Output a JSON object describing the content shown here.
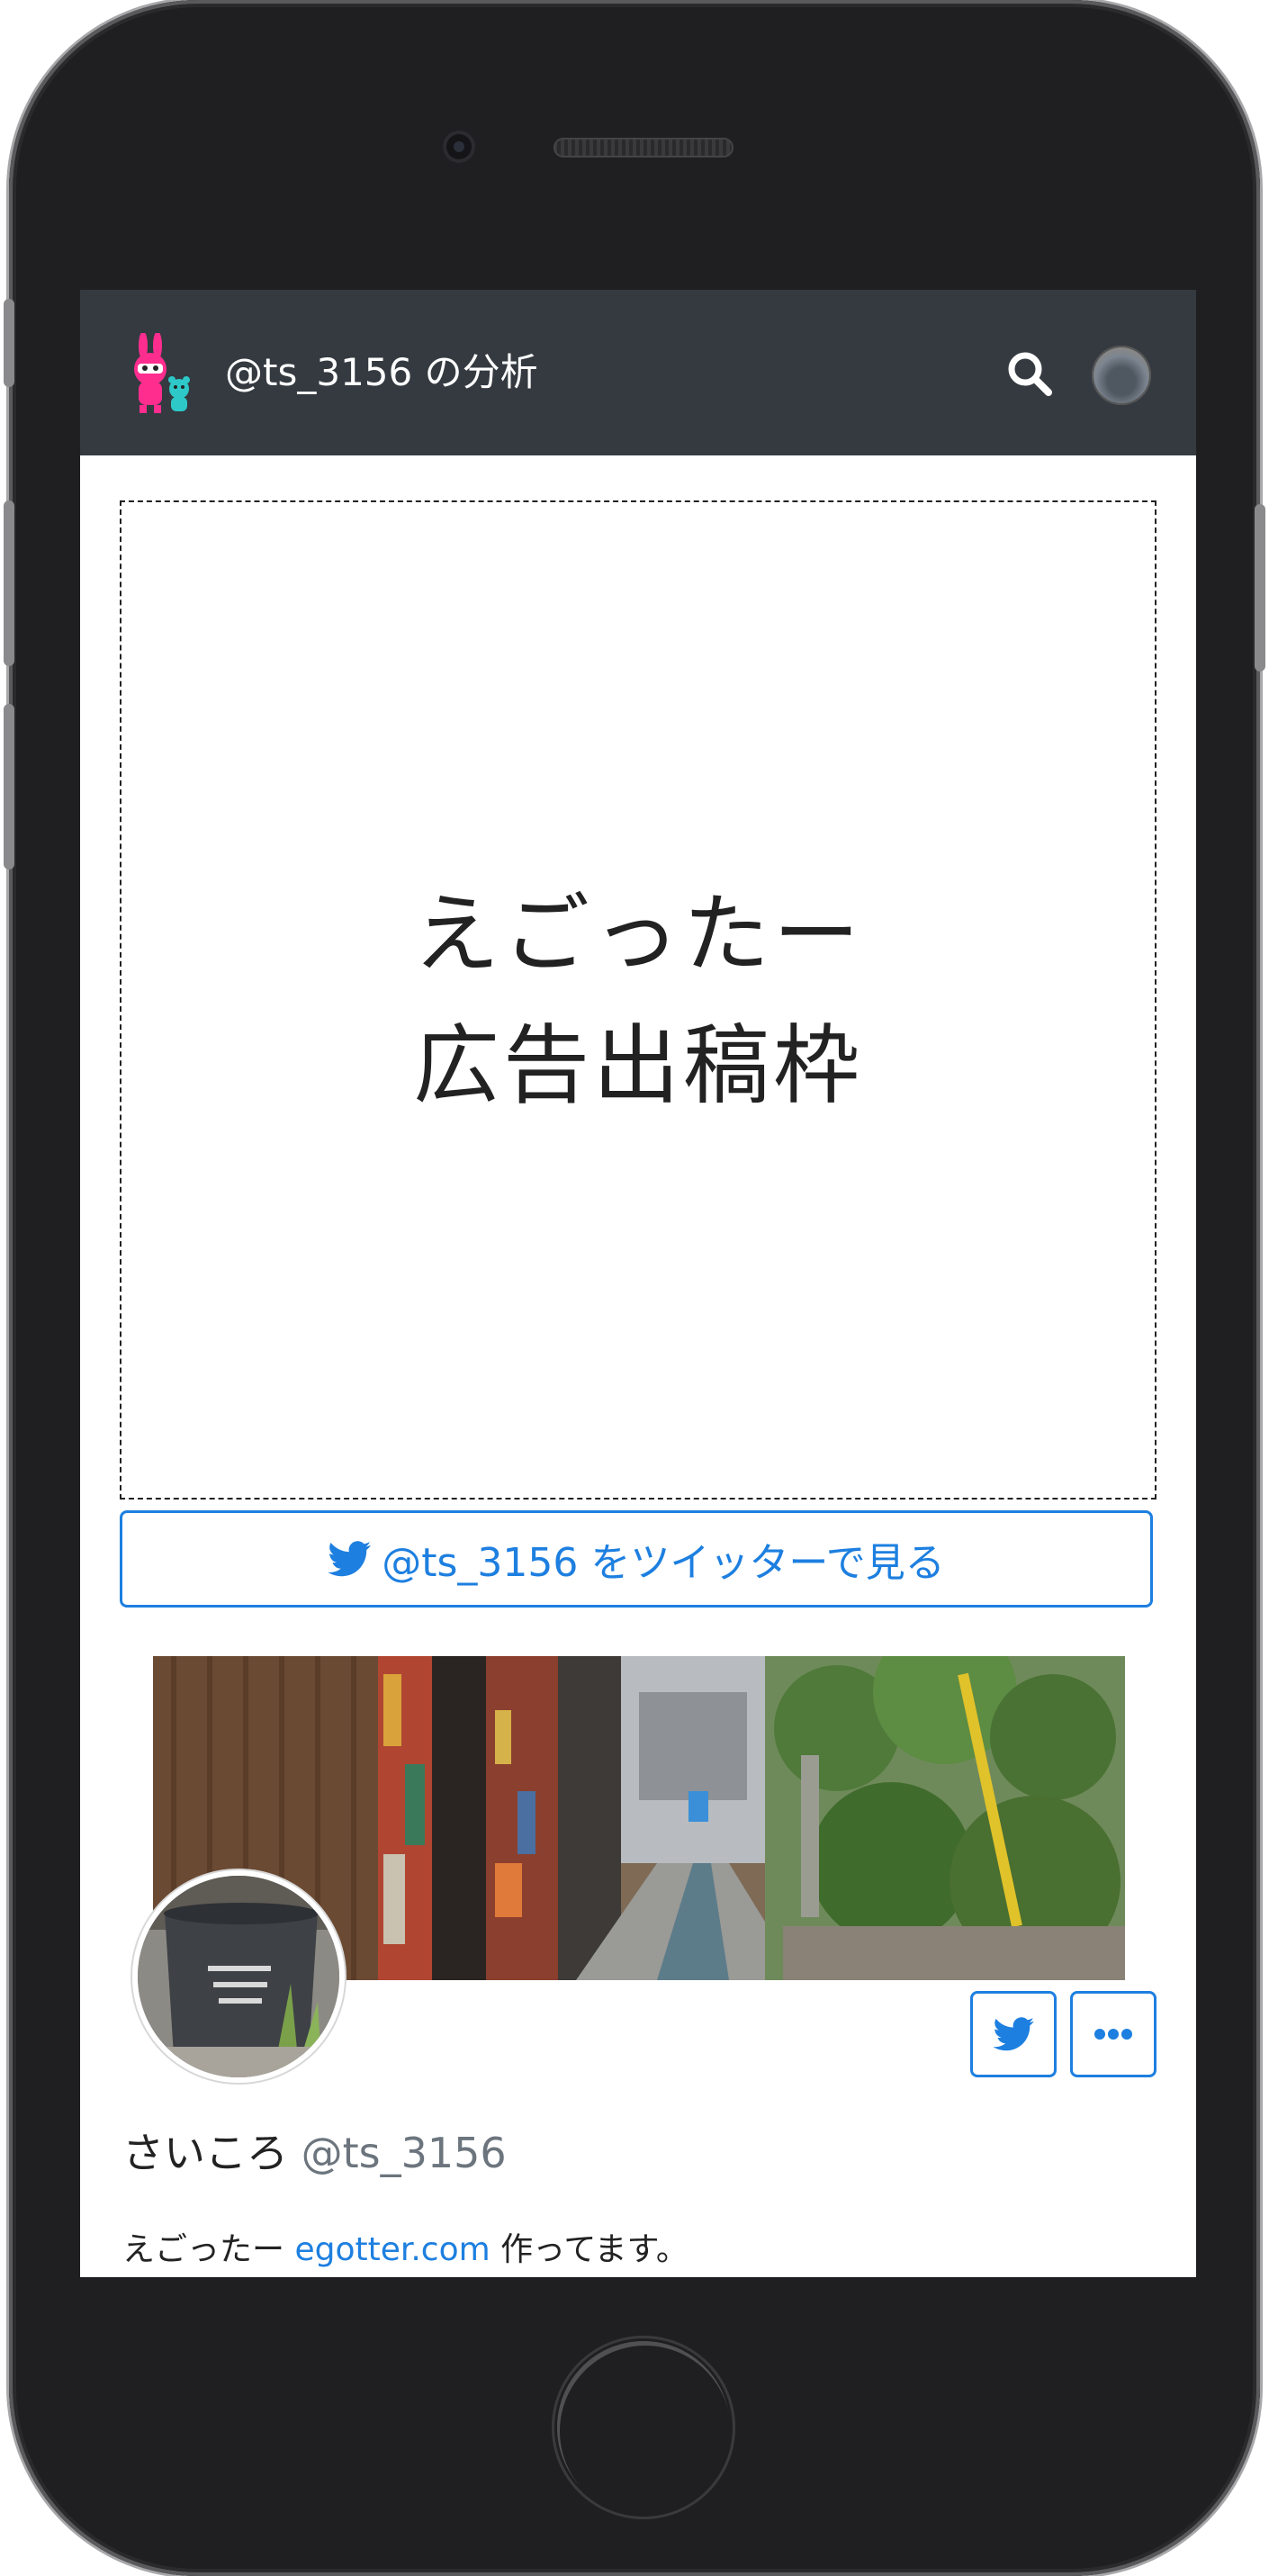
{
  "navbar": {
    "title": "@ts_3156 の分析",
    "logo_icon": "rabbit-mascot-icon",
    "search_icon": "search-icon",
    "avatar_icon": "user-avatar"
  },
  "ad": {
    "line1": "えごったー",
    "line2": "広告出稿枠"
  },
  "twitter_button": {
    "label": "@ts_3156 をツイッターで見る",
    "icon": "twitter-bird-icon"
  },
  "profile": {
    "name": "さいころ",
    "handle": "@ts_3156",
    "bio_prefix": "えごったー ",
    "bio_link": "egotter.com",
    "bio_suffix": " 作ってます。",
    "twitter_icon": "twitter-bird-icon",
    "more_icon": "more-dots-icon"
  },
  "colors": {
    "navbar_bg": "#343a40",
    "accent": "#1d7fe0",
    "handle_gray": "#6c757d"
  }
}
